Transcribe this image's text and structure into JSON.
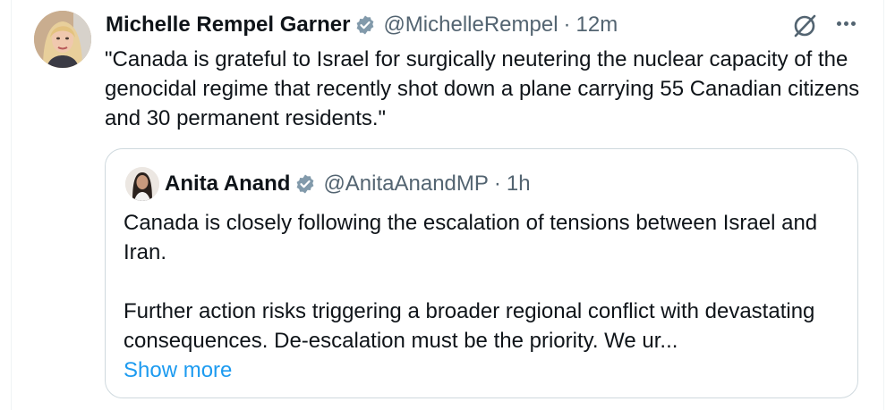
{
  "tweet": {
    "author_name": "Michelle Rempel Garner",
    "handle": "@MichelleRempel",
    "separator": "·",
    "time": "12m",
    "text": "\"Canada is grateful to Israel for surgically neutering the nuclear capacity of the genocidal regime that recently shot down a plane carrying 55 Canadian citizens and 30 permanent residents.\"",
    "verified_color": "#829aab",
    "icons": [
      "grok-icon",
      "more-icon"
    ]
  },
  "quote": {
    "author_name": "Anita Anand",
    "handle": "@AnitaAnandMP",
    "separator": "·",
    "time": "1h",
    "paragraph1": "Canada is closely following the escalation of tensions between Israel and Iran.",
    "paragraph2": "Further action risks triggering a broader regional conflict with devastating consequences. De-escalation must be the priority. We ur...",
    "show_more": "Show more",
    "link_color": "#1d9bf0"
  }
}
